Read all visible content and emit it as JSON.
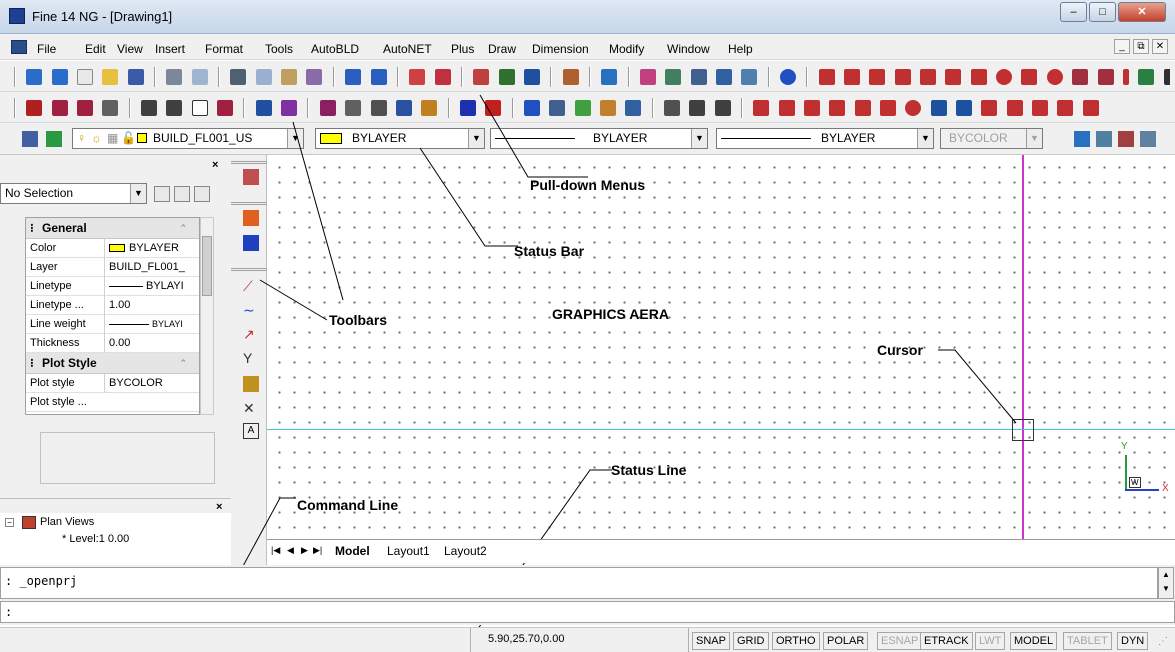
{
  "window": {
    "title": "Fine 14 NG  - [Drawing1]",
    "min": "–",
    "max": "□",
    "close": "✕"
  },
  "menus": [
    "File",
    "Edit",
    "View",
    "Insert",
    "Format",
    "Tools",
    "AutoBLD",
    "AutoNET",
    "Plus",
    "Draw",
    "Dimension",
    "Modify",
    "Window",
    "Help"
  ],
  "mdi": {
    "min": "_",
    "restore": "⧉",
    "close": "✕"
  },
  "properties_bar": {
    "layer": "BUILD_FL001_US",
    "color": "BYLAYER",
    "linetype": "BYLAYER",
    "lineweight": "BYLAYER",
    "plotstyle": "BYCOLOR"
  },
  "properties_panel": {
    "close": "×",
    "selection": "No Selection",
    "groups": [
      {
        "name": "General",
        "rows": [
          {
            "key": "Color",
            "value": "BYLAYER"
          },
          {
            "key": "Layer",
            "value": "BUILD_FL001_"
          },
          {
            "key": "Linetype",
            "value": "BYLAYI"
          },
          {
            "key": "Linetype ...",
            "value": "1.00"
          },
          {
            "key": "Line weight",
            "value": "BYLAYI"
          },
          {
            "key": "Thickness",
            "value": "0.00"
          }
        ]
      },
      {
        "name": "Plot Style",
        "rows": [
          {
            "key": "Plot style",
            "value": "BYCOLOR"
          },
          {
            "key": "Plot style ...",
            "value": ""
          }
        ]
      }
    ]
  },
  "tree": {
    "root": "Plan Views",
    "child": "* Level:1  0.00",
    "close": "×"
  },
  "annotations": {
    "pulldown": "Pull-down Menus",
    "statusbar": "Status Bar",
    "toolbars": "Toolbars",
    "graphics": "GRAPHICS AERA",
    "cursor": "Cursor",
    "statusline": "Status Line",
    "commandline": "Command Line"
  },
  "ucs": {
    "y": "Y",
    "x": "X",
    "w": "W"
  },
  "tabs": [
    "Model",
    "Layout1",
    "Layout2"
  ],
  "command": {
    "history": ": _openprj",
    "prompt": ":"
  },
  "status": {
    "coords": "5.90,25.70,0.00",
    "buttons": [
      {
        "label": "SNAP",
        "active": true
      },
      {
        "label": "GRID",
        "active": true
      },
      {
        "label": "ORTHO",
        "active": true
      },
      {
        "label": "POLAR",
        "active": true
      },
      {
        "label": "ESNAP",
        "active": false
      },
      {
        "label": "ETRACK",
        "active": true
      },
      {
        "label": "LWT",
        "active": false
      },
      {
        "label": "MODEL",
        "active": true
      },
      {
        "label": "TABLET",
        "active": false
      },
      {
        "label": "DYN",
        "active": true
      }
    ]
  },
  "colors": {
    "cursor_v": "#cc33cc",
    "cursor_h": "#33cccc",
    "accent": "#1f3f8f"
  }
}
